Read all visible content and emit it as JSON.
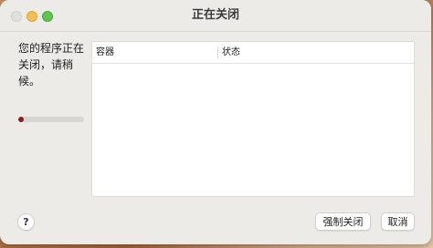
{
  "window": {
    "title": "正在关闭"
  },
  "message": "您的程序正在关闭，请稍候。",
  "progress": {
    "value": 0.08,
    "color": "#8a1c1c"
  },
  "table": {
    "columns": [
      "容器",
      "状态"
    ],
    "rows": []
  },
  "buttons": {
    "help_label": "?",
    "force_quit_label": "强制关闭",
    "cancel_label": "取消"
  },
  "colors": {
    "close_light": "#e0e0de",
    "minimize_light": "#f6be50",
    "maximize_light": "#60c554"
  }
}
